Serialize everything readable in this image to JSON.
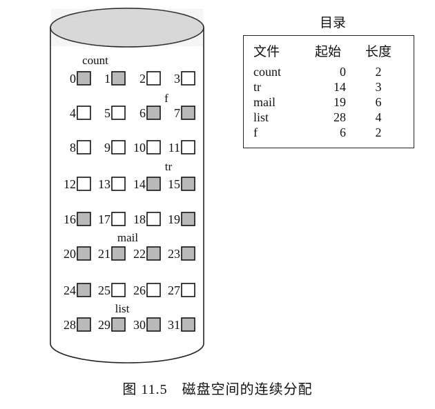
{
  "caption": "图 11.5　磁盘空间的连续分配",
  "directory": {
    "title": "目录",
    "headers": [
      "文件",
      "起始",
      "长度"
    ],
    "rows": [
      {
        "file": "count",
        "start": "0",
        "length": "2"
      },
      {
        "file": "tr",
        "start": "14",
        "length": "3"
      },
      {
        "file": "mail",
        "start": "19",
        "length": "6"
      },
      {
        "file": "list",
        "start": "28",
        "length": "4"
      },
      {
        "file": "f",
        "start": "6",
        "length": "2"
      }
    ]
  },
  "disk": {
    "block_numbers": [
      "0",
      "1",
      "2",
      "3",
      "4",
      "5",
      "6",
      "7",
      "8",
      "9",
      "10",
      "11",
      "12",
      "13",
      "14",
      "15",
      "16",
      "17",
      "18",
      "19",
      "20",
      "21",
      "22",
      "23",
      "24",
      "25",
      "26",
      "27",
      "28",
      "29",
      "30",
      "31"
    ],
    "file_labels": [
      "count",
      "f",
      "tr",
      "mail",
      "list"
    ]
  }
}
